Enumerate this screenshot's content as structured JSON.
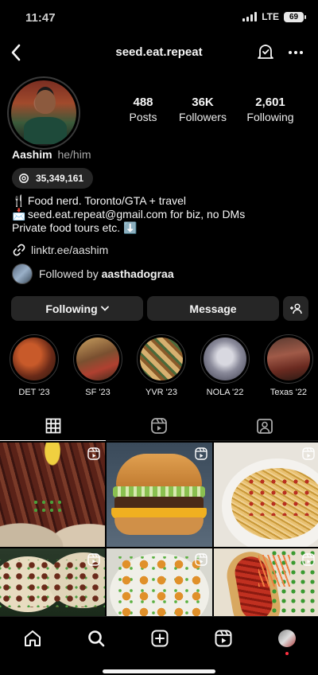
{
  "status_bar": {
    "time": "11:47",
    "network": "LTE",
    "battery": "69"
  },
  "header": {
    "username": "seed.eat.repeat",
    "back_icon": "chevron-left-icon",
    "bell_icon": "bell-icon",
    "more_icon": "more-horizontal-icon"
  },
  "profile": {
    "stats": [
      {
        "value": "488",
        "label": "Posts"
      },
      {
        "value": "36K",
        "label": "Followers"
      },
      {
        "value": "2,601",
        "label": "Following"
      }
    ],
    "name": "Aashim",
    "pronouns": "he/him",
    "threads_count": "35,349,161",
    "bio_lines": [
      {
        "emoji": "🍴",
        "text": "Food nerd. Toronto/GTA + travel"
      },
      {
        "emoji": "📩",
        "text": "seed.eat.repeat@gmail.com for biz, no DMs"
      },
      {
        "emoji": "",
        "text": "Private food tours etc. ⬇️"
      }
    ],
    "link": "linktr.ee/aashim",
    "followed_by_prefix": "Followed by ",
    "followed_by_name": "aasthadograa"
  },
  "actions": {
    "following": "Following",
    "message": "Message"
  },
  "highlights": [
    {
      "label": "DET '23",
      "color": "#8a3a24"
    },
    {
      "label": "SF '23",
      "color": "#6a5030"
    },
    {
      "label": "YVR '23",
      "color": "#a07a40"
    },
    {
      "label": "NOLA '22",
      "color": "#8a8a9a"
    },
    {
      "label": "Texas '22",
      "color": "#6a3028"
    }
  ],
  "tabs": [
    "grid-icon",
    "reels-icon",
    "tagged-icon"
  ],
  "accent": "#ff3040"
}
